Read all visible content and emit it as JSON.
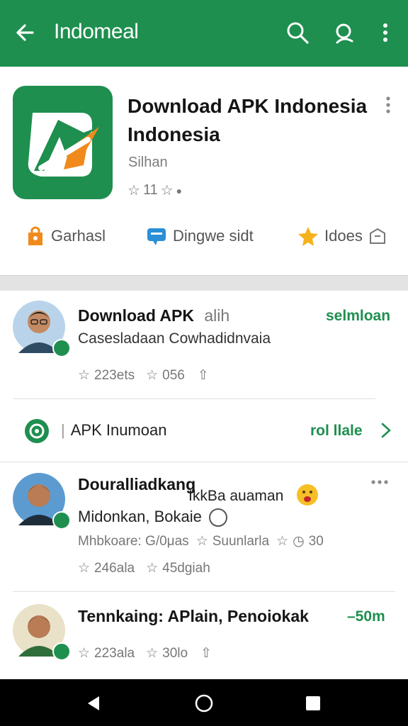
{
  "appbar": {
    "title": "Indomeal"
  },
  "app": {
    "title_line1": "Download APK Indonesia",
    "title_line2": "Indonesia",
    "developer": "Silhan",
    "rating": "11"
  },
  "actions": [
    {
      "label": "Garhasl"
    },
    {
      "label": "Dingwe sidt"
    },
    {
      "label": "Idoes"
    }
  ],
  "review1": {
    "name": "Download APK",
    "name_suffix": "alih",
    "action": "selmloan",
    "text": "Casesladaan Cowhadidnvaia",
    "meta1": "223ets",
    "meta2": "056"
  },
  "promo": {
    "label": "APK Inumoan",
    "action": "rol llale"
  },
  "review2": {
    "name": "Douralliadkang",
    "overlay": "IkkBa auaman",
    "text": "Midonkan, Bokaie",
    "sub_a": "Mhbkoare: G/0μas",
    "sub_b": "Suunlarla",
    "sub_c": "30",
    "meta1": "246ala",
    "meta2": "45dgiah"
  },
  "review3": {
    "name": "Tennkaing: APlain, Penoiokak",
    "action": "–50m",
    "meta1": "223ala",
    "meta2": "30lo"
  },
  "colors": {
    "brand": "#1e8f4f",
    "accent": "#f08a1c"
  }
}
